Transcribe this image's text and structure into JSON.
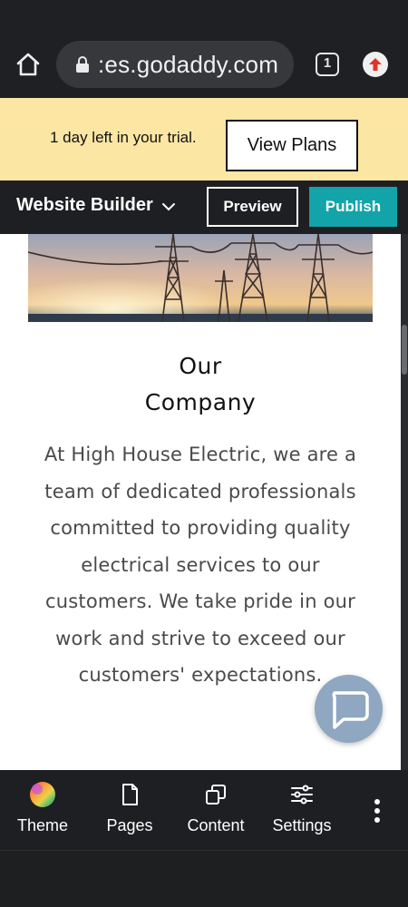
{
  "browser": {
    "url": ":es.godaddy.com",
    "tab_count": "1"
  },
  "trial": {
    "message": "1 day left in your trial.",
    "cta_label": "View Plans"
  },
  "builder": {
    "title": "Website Builder",
    "preview_label": "Preview",
    "publish_label": "Publish",
    "publish_color": "#12a4a8"
  },
  "site": {
    "section_title_line1": "Our",
    "section_title_line2": "Company",
    "body": "At High House Electric, we are a team of dedicated professionals committed to providing quality electrical services to our customers. We take pride in our work and strive to exceed our customers' expectations."
  },
  "toolbar": {
    "items": [
      {
        "label": "Theme",
        "icon": "theme-icon"
      },
      {
        "label": "Pages",
        "icon": "page-icon"
      },
      {
        "label": "Content",
        "icon": "copy-icon"
      },
      {
        "label": "Settings",
        "icon": "sliders-icon"
      }
    ],
    "more_icon": "more-vertical-icon"
  }
}
